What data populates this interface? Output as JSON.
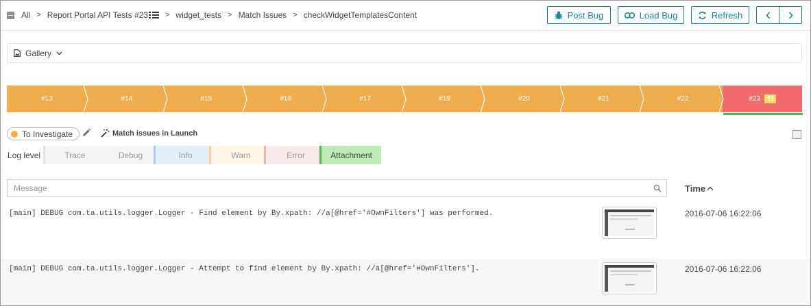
{
  "breadcrumb": {
    "items": [
      "All",
      "Report Portal API Tests #23",
      "widget_tests",
      "Match Issues",
      "checkWidgetTemplatesContent"
    ]
  },
  "toolbar": {
    "post_bug": "Post Bug",
    "load_bug": "Load Bug",
    "refresh": "Refresh"
  },
  "gallery": {
    "label": "Gallery"
  },
  "history": {
    "items": [
      {
        "label": "#13",
        "status": "orange"
      },
      {
        "label": "#14",
        "status": "orange"
      },
      {
        "label": "#15",
        "status": "orange"
      },
      {
        "label": "#16",
        "status": "orange"
      },
      {
        "label": "#17",
        "status": "orange"
      },
      {
        "label": "#19",
        "status": "orange"
      },
      {
        "label": "#20",
        "status": "orange"
      },
      {
        "label": "#21",
        "status": "orange"
      },
      {
        "label": "#22",
        "status": "orange"
      },
      {
        "label": "#23",
        "status": "red",
        "badge": "TI"
      }
    ],
    "colors": {
      "orange": "#f0ad4e",
      "red": "#f36c6c",
      "active_underline": "#55b457"
    }
  },
  "defect": {
    "type_label": "To Investigate",
    "type_color": "#f7ae3b",
    "match_label": "Match issues in Launch"
  },
  "log_levels": {
    "label": "Log level",
    "levels": [
      {
        "label": "Trace",
        "bg": "#f5f5f5",
        "border": "#e3e3e3"
      },
      {
        "label": "Debug",
        "bg": "#f5f5f5",
        "border": "#f5f5f5"
      },
      {
        "label": "Info",
        "bg": "#e2eff9",
        "border": "#a5cbe6"
      },
      {
        "label": "Warn",
        "bg": "#fef6e6",
        "border": "#f8cf9a"
      },
      {
        "label": "Error",
        "bg": "#f8e9ea",
        "border": "#eab5b9"
      },
      {
        "label": "Attachment",
        "bg": "#bdeab5",
        "border": "#55b457",
        "active": true
      }
    ]
  },
  "logs": {
    "search_placeholder": "Message",
    "time_header": "Time",
    "rows": [
      {
        "message": "[main] DEBUG com.ta.utils.logger.Logger - Find element by By.xpath: //a[@href='#OwnFilters'] was performed.",
        "time": "2016-07-06 16:22:06"
      },
      {
        "message": "[main] DEBUG com.ta.utils.logger.Logger - Attempt to find element by By.xpath: //a[@href='#OwnFilters'].",
        "time": "2016-07-06 16:22:06"
      }
    ]
  }
}
